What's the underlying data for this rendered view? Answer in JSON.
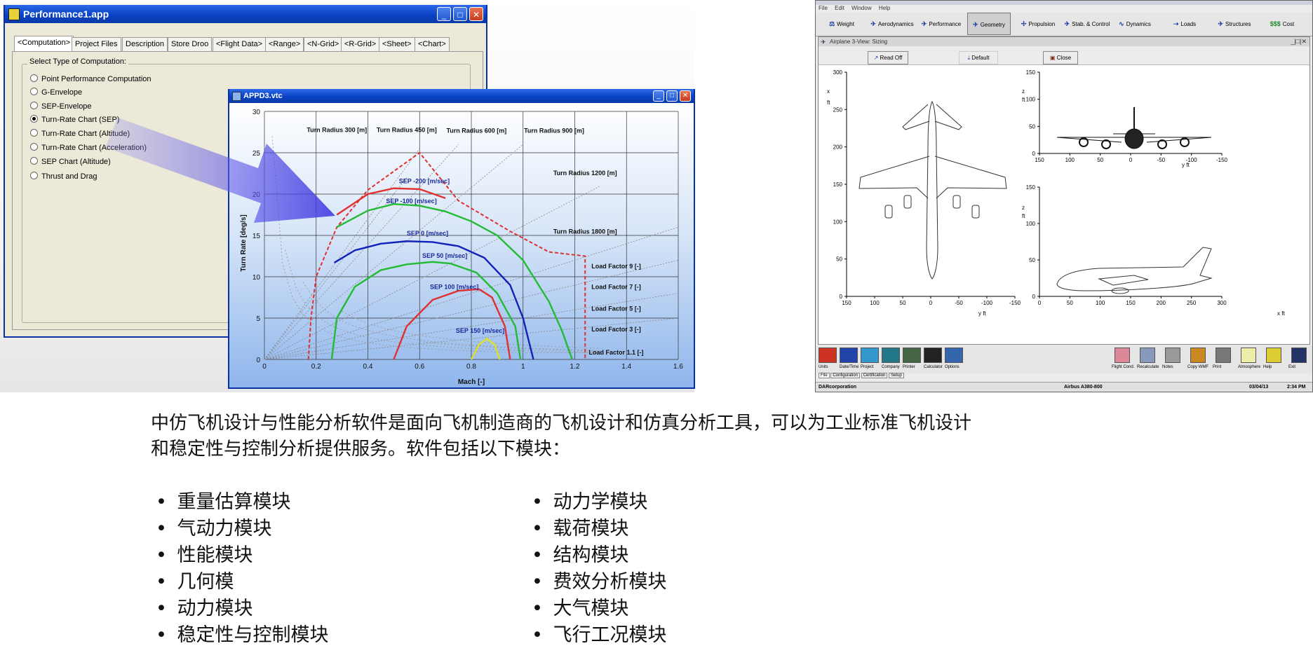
{
  "performance_window": {
    "title": "Performance1.app",
    "tabs": [
      "<Computation>",
      "Project Files",
      "Description",
      "Store Droo",
      "<Flight Data>",
      "<Range>",
      "<N-Grid>",
      "<R-Grid>",
      "<Sheet>",
      "<Chart>"
    ],
    "group_label": "Select Type of Computation:",
    "options": [
      "Point Performance Computation",
      "G-Envelope",
      "SEP-Envelope",
      "Turn-Rate Chart (SEP)",
      "Turn-Rate Chart (Altitude)",
      "Turn-Rate Chart (Acceleration)",
      "SEP Chart (Altitude)",
      "Thrust and Drag"
    ],
    "selected_option": "Turn-Rate Chart (SEP)"
  },
  "chart_window": {
    "title": "APPD3.vtc"
  },
  "chart_data": {
    "type": "line",
    "xlabel": "Mach [-]",
    "ylabel": "Turn Rate [deg/s]",
    "xlim": [
      0,
      1.6
    ],
    "ylim": [
      0,
      30
    ],
    "xticks": [
      "0",
      "0.2",
      "0.4",
      "0.6",
      "0.8",
      "1",
      "1.2",
      "1.4",
      "1.6"
    ],
    "yticks": [
      "0",
      "5",
      "10",
      "15",
      "20",
      "25",
      "30"
    ],
    "grid": true,
    "series": [
      {
        "name": "SEP -200 [m/sec]",
        "color": "#e03030",
        "points": [
          [
            0.28,
            17.5
          ],
          [
            0.4,
            20.0
          ],
          [
            0.5,
            20.7
          ],
          [
            0.6,
            20.6
          ],
          [
            0.7,
            19.5
          ]
        ]
      },
      {
        "name": "SEP -100 [m/sec]",
        "color": "#22bb33",
        "points": [
          [
            0.28,
            16.0
          ],
          [
            0.4,
            18.0
          ],
          [
            0.5,
            18.8
          ],
          [
            0.6,
            18.6
          ],
          [
            0.7,
            17.9
          ],
          [
            0.8,
            16.7
          ],
          [
            0.9,
            15.0
          ],
          [
            1.0,
            12.0
          ],
          [
            1.1,
            7.0
          ],
          [
            1.15,
            3.5
          ],
          [
            1.19,
            0.0
          ]
        ]
      },
      {
        "name": "SEP 0 [m/sec]",
        "color": "#1122bb",
        "points": [
          [
            0.27,
            11.7
          ],
          [
            0.35,
            13.2
          ],
          [
            0.45,
            14.0
          ],
          [
            0.55,
            14.3
          ],
          [
            0.65,
            14.2
          ],
          [
            0.75,
            13.7
          ],
          [
            0.85,
            12.3
          ],
          [
            0.95,
            9.0
          ],
          [
            1.0,
            5.0
          ],
          [
            1.04,
            0.0
          ]
        ]
      },
      {
        "name": "SEP 50 [m/sec]",
        "color": "#22bb33",
        "points": [
          [
            0.26,
            0.0
          ],
          [
            0.28,
            5.0
          ],
          [
            0.35,
            8.8
          ],
          [
            0.45,
            10.8
          ],
          [
            0.55,
            11.5
          ],
          [
            0.65,
            11.8
          ],
          [
            0.72,
            11.6
          ],
          [
            0.82,
            10.5
          ],
          [
            0.9,
            8.0
          ],
          [
            0.97,
            4.0
          ],
          [
            0.99,
            0.0
          ]
        ]
      },
      {
        "name": "SEP 100 [m/sec]",
        "color": "#e03030",
        "points": [
          [
            0.5,
            0.0
          ],
          [
            0.55,
            4.0
          ],
          [
            0.65,
            7.2
          ],
          [
            0.75,
            8.3
          ],
          [
            0.83,
            8.5
          ],
          [
            0.88,
            7.5
          ],
          [
            0.93,
            4.0
          ],
          [
            0.95,
            0.0
          ]
        ]
      },
      {
        "name": "SEP 150 [m/sec]",
        "color": "#e0e020",
        "points": [
          [
            0.8,
            0.0
          ],
          [
            0.83,
            1.8
          ],
          [
            0.86,
            2.5
          ],
          [
            0.89,
            1.8
          ],
          [
            0.91,
            0.0
          ]
        ]
      }
    ],
    "max_envelope": {
      "color": "#e03030",
      "points": [
        [
          0.17,
          0.0
        ],
        [
          0.18,
          5.0
        ],
        [
          0.2,
          10.0
        ],
        [
          0.28,
          16.0
        ],
        [
          0.4,
          20.5
        ],
        [
          0.6,
          25.0
        ],
        [
          0.75,
          19.2
        ],
        [
          0.95,
          15.5
        ],
        [
          1.1,
          13.0
        ],
        [
          1.24,
          12.5
        ],
        [
          1.24,
          0.0
        ]
      ]
    },
    "turn_radius_labels": [
      "Turn Radius 300 [m]",
      "Turn Radius 450 [m]",
      "Turn Radius 600 [m]",
      "Turn Radius 900 [m]",
      "Turn Radius 1200 [m]",
      "Turn Radius 1800 [m]"
    ],
    "load_factor_labels": [
      "Load Factor 9 [-]",
      "Load Factor 7 [-]",
      "Load Factor 5 [-]",
      "Load Factor 3 [-]",
      "Load Factor 1.1 [-]"
    ]
  },
  "sizing_app": {
    "menu": [
      "File",
      "Edit",
      "Window",
      "Help"
    ],
    "modules": [
      "Weight",
      "Aerodynamics",
      "Performance",
      "Geometry",
      "Propulsion",
      "Stab. & Control",
      "Dynamics",
      "Loads",
      "Structures",
      "Cost"
    ],
    "selected_module": "Geometry",
    "subwindow_title": "Airplane 3-View: Sizing",
    "buttons": [
      "Read Off",
      "Default",
      "Close"
    ],
    "top_view": {
      "x_axis_label": "y   ft",
      "y_axis_label": "x",
      "y_unit": "ft",
      "x_ticks": [
        "150",
        "100",
        "50",
        "0",
        "-50",
        "-100",
        "-150"
      ],
      "y_ticks": [
        "300",
        "250",
        "200",
        "150",
        "100",
        "50",
        "0"
      ]
    },
    "front_view": {
      "x_axis_label": "y   ft",
      "y_axis_label": "z",
      "y_unit": "ft",
      "x_ticks": [
        "150",
        "100",
        "50",
        "0",
        "-50",
        "-100",
        "-150"
      ],
      "y_ticks": [
        "150",
        "100",
        "50",
        "0"
      ]
    },
    "side_view": {
      "x_axis_label": "x   ft",
      "y_axis_label": "z",
      "y_unit": "ft",
      "x_ticks": [
        "0",
        "50",
        "100",
        "150",
        "200",
        "250",
        "300"
      ],
      "y_ticks": [
        "150",
        "100",
        "50",
        "0"
      ]
    },
    "bottom_tools_left": [
      "Units",
      "Date/Time",
      "Project",
      "Company",
      "Printer",
      "Calculator",
      "Options"
    ],
    "bottom_tools_right": [
      "Flight Cond.",
      "Recalculate",
      "Notes",
      "Copy WMF",
      "Print",
      "Atmosphere",
      "Help",
      "Exit"
    ],
    "bottom_tabs": [
      "File",
      "Configuration",
      "Certification",
      "Setup"
    ],
    "status": {
      "company": "DARcorporation",
      "aircraft": "Airbus A380-800",
      "date": "03/04/13",
      "time": "2:34 PM"
    }
  },
  "description": {
    "line1": "中仿飞机设计与性能分析软件是面向飞机制造商的飞机设计和仿真分析工具，可以为工业标准飞机设计",
    "line2": "和稳定性与控制分析提供服务。软件包括以下模块：",
    "list_left": [
      "重量估算模块",
      "气动力模块",
      "性能模块",
      "几何模",
      "动力模块",
      "稳定性与控制模块"
    ],
    "list_right": [
      "动力学模块",
      "载荷模块",
      "结构模块",
      "费效分析模块",
      "大气模块",
      "飞行工况模块"
    ]
  }
}
